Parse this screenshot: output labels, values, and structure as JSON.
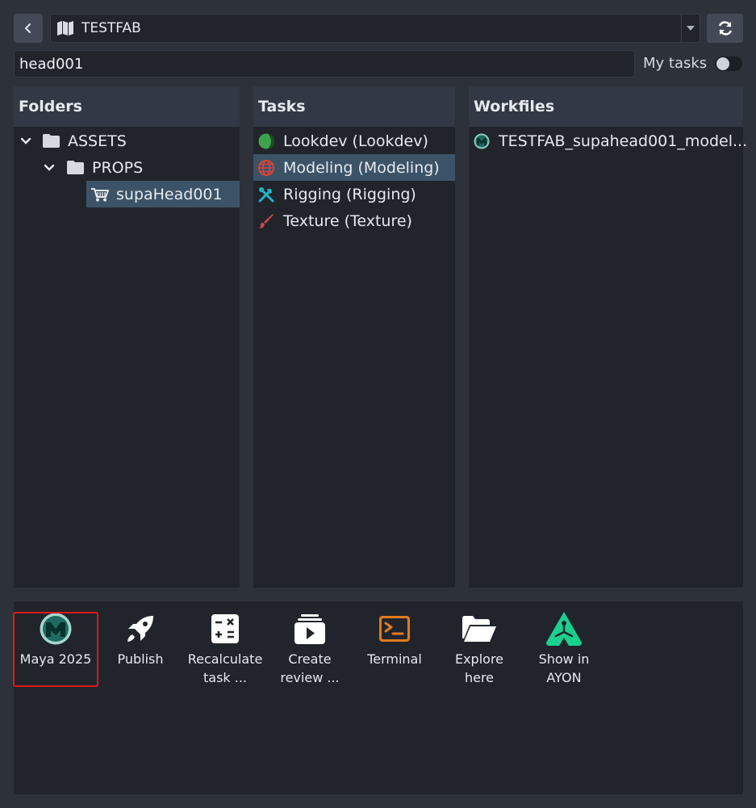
{
  "project": {
    "name": "TESTFAB"
  },
  "search": {
    "value": "head001",
    "placeholder": ""
  },
  "my_tasks": {
    "label": "My tasks",
    "enabled": false
  },
  "folders": {
    "header": "Folders",
    "items": [
      {
        "label": "ASSETS",
        "icon": "folder-icon",
        "expanded": true
      },
      {
        "label": "PROPS",
        "icon": "folder-icon",
        "expanded": true
      },
      {
        "label": "supaHead001",
        "icon": "cart-icon",
        "selected": true
      }
    ]
  },
  "tasks": {
    "header": "Tasks",
    "items": [
      {
        "label": "Lookdev (Lookdev)",
        "icon": "moon-icon",
        "color": "#3fa34d"
      },
      {
        "label": "Modeling (Modeling)",
        "icon": "globe-icon",
        "color": "#d9453b",
        "selected": true
      },
      {
        "label": "Rigging (Rigging)",
        "icon": "tools-icon",
        "color": "#1fb5c9"
      },
      {
        "label": "Texture (Texture)",
        "icon": "brush-icon",
        "color": "#e04545"
      }
    ]
  },
  "workfiles": {
    "header": "Workfiles",
    "items": [
      {
        "label": "TESTFAB_supahead001_model...",
        "icon": "maya-icon"
      }
    ]
  },
  "actions": [
    {
      "label": "Maya 2025",
      "icon": "maya-icon"
    },
    {
      "label": "Publish",
      "icon": "rocket-icon"
    },
    {
      "label": "Recalculate task ...",
      "icon": "calculator-icon"
    },
    {
      "label": "Create review ...",
      "icon": "video-icon"
    },
    {
      "label": "Terminal",
      "icon": "terminal-icon",
      "color": "#e07b1c"
    },
    {
      "label": "Explore here",
      "icon": "folder-open-icon"
    },
    {
      "label": "Show in AYON",
      "icon": "ayon-icon",
      "color": "#19d18f"
    }
  ]
}
